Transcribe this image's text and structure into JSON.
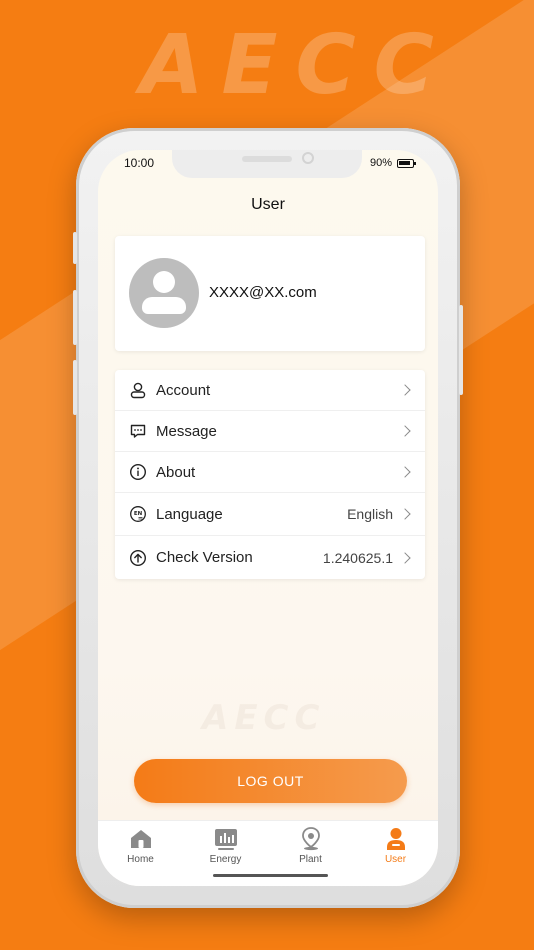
{
  "brand": {
    "logo_text": "AECC"
  },
  "status_bar": {
    "time": "10:00",
    "battery": "90%"
  },
  "header": {
    "title": "User"
  },
  "profile": {
    "email": "XXXX@XX.com"
  },
  "menu": [
    {
      "label": "Account",
      "value": "",
      "icon": "user-outline-icon"
    },
    {
      "label": "Message",
      "value": "",
      "icon": "message-icon"
    },
    {
      "label": "About",
      "value": "",
      "icon": "info-icon"
    },
    {
      "label": "Language",
      "value": "English",
      "icon": "language-en-icon"
    },
    {
      "label": "Check Version",
      "value": "1.240625.1",
      "icon": "upload-arrow-icon"
    }
  ],
  "actions": {
    "logout_label": "LOG OUT"
  },
  "tabs": [
    {
      "label": "Home",
      "icon": "home-icon",
      "active": false
    },
    {
      "label": "Energy",
      "icon": "energy-chart-icon",
      "active": false
    },
    {
      "label": "Plant",
      "icon": "plant-location-icon",
      "active": false
    },
    {
      "label": "User",
      "icon": "user-icon",
      "active": true
    }
  ],
  "colors": {
    "accent": "#f47b17",
    "background": "#f57d12",
    "inactive_icon": "#8a8a8a"
  }
}
